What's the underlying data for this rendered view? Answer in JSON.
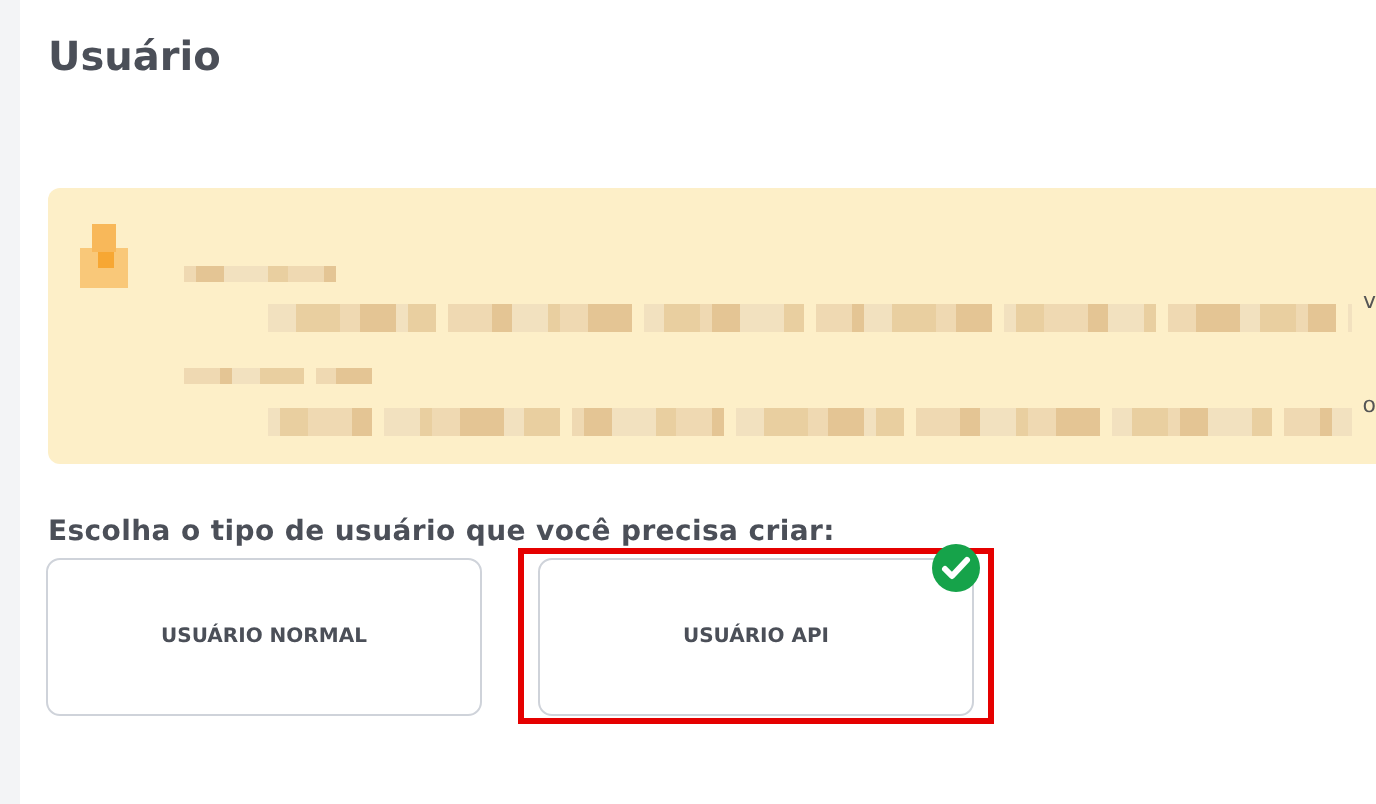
{
  "page_title": "Usuário",
  "notice": {
    "line_endings": [
      "v",
      "o"
    ]
  },
  "question": "Escolha o tipo de usuário que você precisa criar:",
  "user_types": [
    {
      "label": "USUÁRIO NORMAL",
      "selected": false
    },
    {
      "label": "USUÁRIO API",
      "selected": true
    }
  ]
}
